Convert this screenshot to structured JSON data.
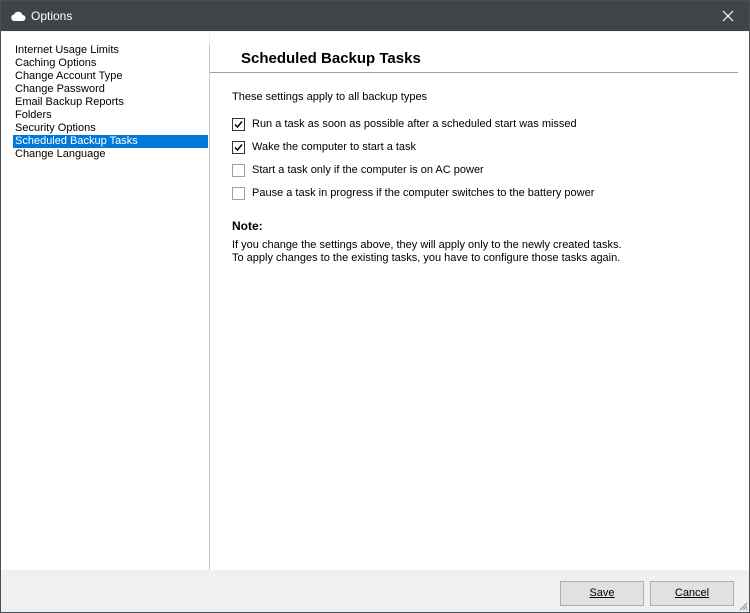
{
  "window": {
    "title": "Options",
    "icon": "cloud-icon",
    "close_icon": "close-icon"
  },
  "sidebar": {
    "items": [
      {
        "label": "Internet Usage Limits",
        "selected": false
      },
      {
        "label": "Caching Options",
        "selected": false
      },
      {
        "label": "Change Account Type",
        "selected": false
      },
      {
        "label": "Change Password",
        "selected": false
      },
      {
        "label": "Email Backup Reports",
        "selected": false
      },
      {
        "label": "Folders",
        "selected": false
      },
      {
        "label": "Security Options",
        "selected": false
      },
      {
        "label": "Scheduled Backup Tasks",
        "selected": true
      },
      {
        "label": "Change Language",
        "selected": false
      }
    ]
  },
  "main": {
    "heading": "Scheduled Backup Tasks",
    "intro": "These settings apply to all backup types",
    "options": [
      {
        "label": "Run a task as soon as possible after a scheduled start was missed",
        "checked": true
      },
      {
        "label": "Wake the computer to start a task",
        "checked": true
      },
      {
        "label": "Start a task only if the computer is on AC power",
        "checked": false
      },
      {
        "label": "Pause a task in progress if the computer switches to the battery power",
        "checked": false
      }
    ],
    "note_title": "Note:",
    "note_lines": [
      "If you change the settings above, they will apply only to the newly created tasks.",
      "To apply changes to the existing tasks, you have to configure those tasks again."
    ]
  },
  "footer": {
    "save_label": "Save",
    "cancel_label": "Cancel"
  },
  "colors": {
    "titlebar": "#3f4448",
    "selection": "#0078d7"
  }
}
